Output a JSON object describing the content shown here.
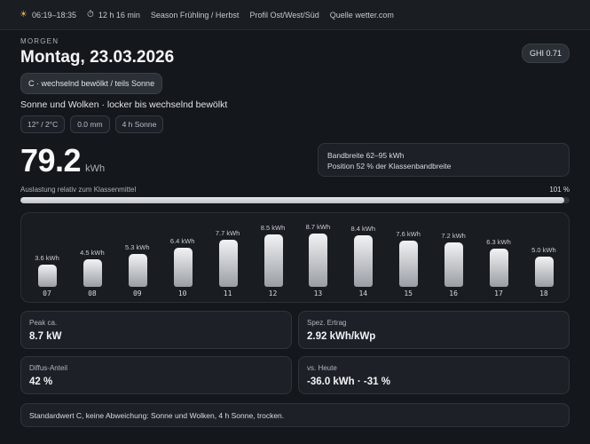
{
  "topbar": {
    "sun_times": "06:19–18:35",
    "day_length": "12 h 16 min",
    "season": "Season Frühling / Herbst",
    "profile": "Profil Ost/West/Süd",
    "source": "Quelle wetter.com",
    "sun_icon": "sun-icon",
    "clock_icon": "clock-icon"
  },
  "header": {
    "kicker": "MORGEN",
    "date": "Montag, 23.03.2026",
    "ghi": "GHI 0.71",
    "condition_pill": "C · wechselnd bewölkt / teils Sonne",
    "description": "Sonne und Wolken · locker bis wechselnd bewölkt",
    "chips": [
      "12° / 2°C",
      "0.0 mm",
      "4 h Sonne"
    ]
  },
  "forecast": {
    "value": "79.2",
    "unit": "kWh",
    "band_line1": "Bandbreite 62–95 kWh",
    "band_line2": "Position 52 % der Klassenbandbreite",
    "util_label": "Auslastung relativ zum Klassenmittel",
    "util_pct_label": "101 %",
    "util_fraction": 0.99
  },
  "hours": [
    {
      "hour": "07",
      "kwh": 3.6,
      "label": "3.6 kWh"
    },
    {
      "hour": "08",
      "kwh": 4.5,
      "label": "4.5 kWh"
    },
    {
      "hour": "09",
      "kwh": 5.3,
      "label": "5.3 kWh"
    },
    {
      "hour": "10",
      "kwh": 6.4,
      "label": "6.4 kWh"
    },
    {
      "hour": "11",
      "kwh": 7.7,
      "label": "7.7 kWh"
    },
    {
      "hour": "12",
      "kwh": 8.5,
      "label": "8.5 kWh"
    },
    {
      "hour": "13",
      "kwh": 8.7,
      "label": "8.7 kWh"
    },
    {
      "hour": "14",
      "kwh": 8.4,
      "label": "8.4 kWh"
    },
    {
      "hour": "15",
      "kwh": 7.6,
      "label": "7.6 kWh"
    },
    {
      "hour": "16",
      "kwh": 7.2,
      "label": "7.2 kWh"
    },
    {
      "hour": "17",
      "kwh": 6.3,
      "label": "6.3 kWh"
    },
    {
      "hour": "18",
      "kwh": 5.0,
      "label": "5.0 kWh"
    }
  ],
  "stats": {
    "peak_label": "Peak ca.",
    "peak_value": "8.7 kW",
    "spec_label": "Spez. Ertrag",
    "spec_value": "2.92 kWh/kWp",
    "diffuse_label": "Diffus-Anteil",
    "diffuse_value": "42 %",
    "vs_label": "vs. Heute",
    "vs_value": "-36.0 kWh · -31 %"
  },
  "footer": "Standardwert C, keine Abweichung: Sonne und Wolken, 4 h Sonne, trocken.",
  "colors": {
    "background": "#14171b",
    "accent_sun": "#f4b431",
    "bar_top": "#f1f2f4",
    "bar_bottom": "#9a9ea4"
  }
}
